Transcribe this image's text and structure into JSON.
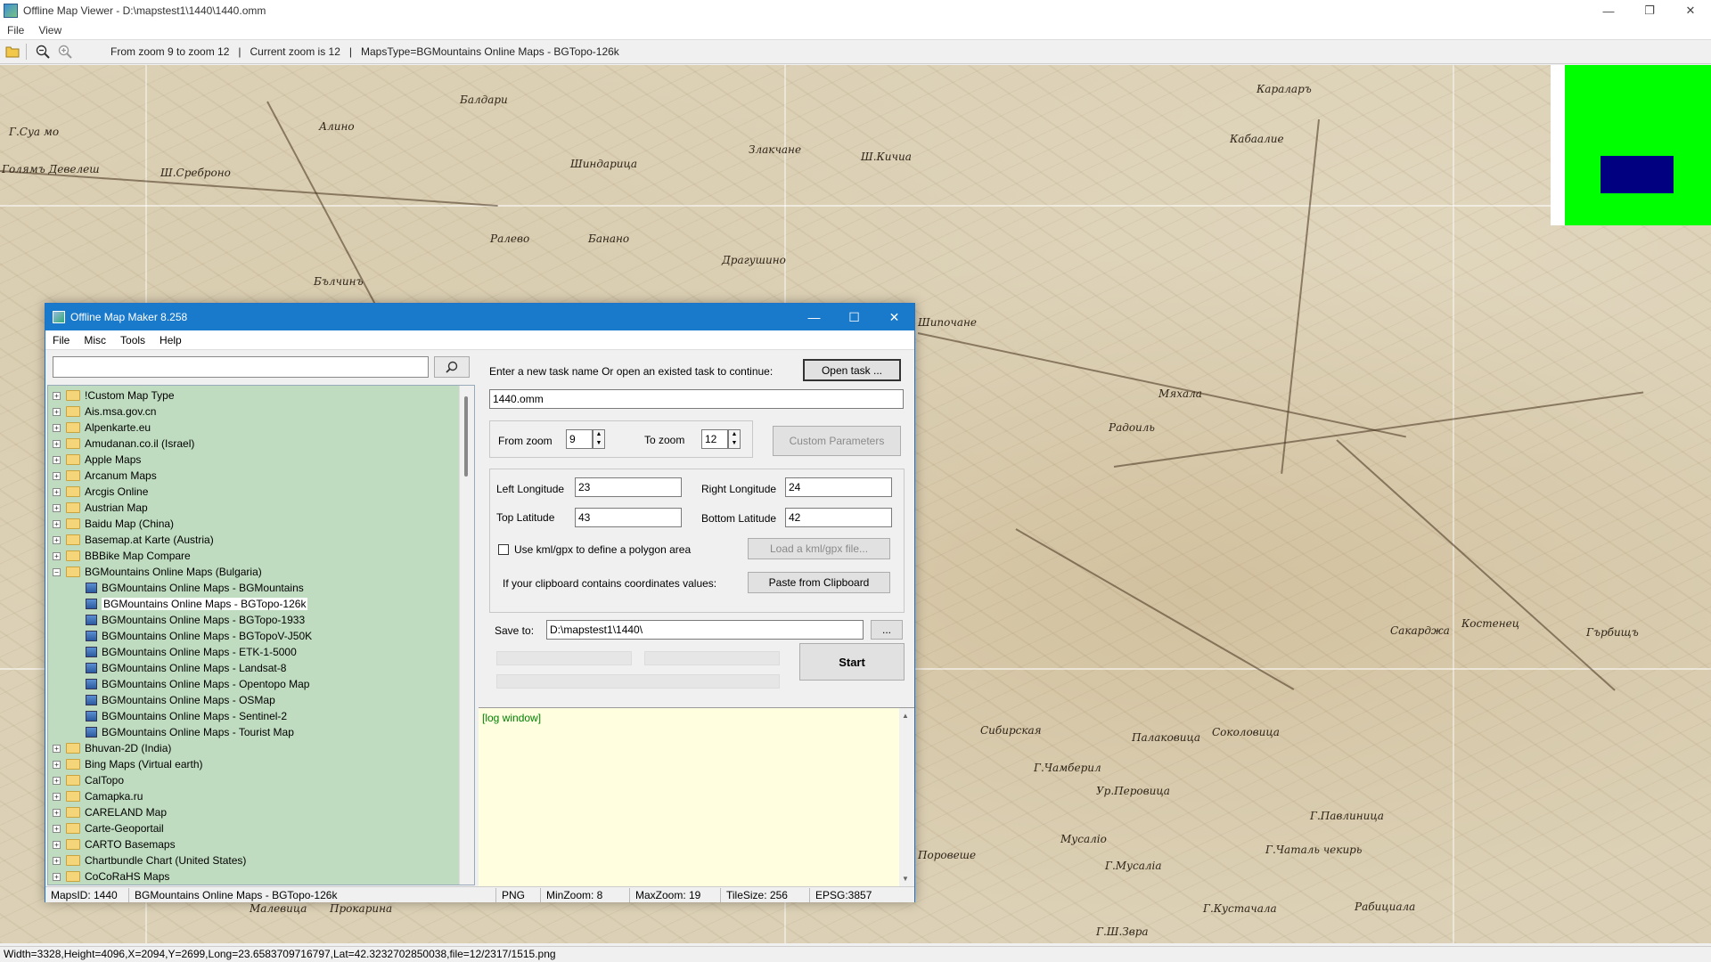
{
  "window": {
    "title": "Offline Map Viewer - D:\\mapstest1\\1440\\1440.omm",
    "controls": [
      "—",
      "❐",
      "✕"
    ]
  },
  "menubar": {
    "file": "File",
    "view": "View"
  },
  "toolbar": {
    "open_icon": "folder-open-icon",
    "zoom_out_icon": "zoom-out-icon",
    "zoom_in_icon": "zoom-in-icon",
    "info": "From zoom 9 to zoom 12   |   Current zoom is 12   |   MapsType=BGMountains Online Maps - BGTopo-126k"
  },
  "map": {
    "labels": [
      "Г.Суа мо",
      "Голямъ Девелеш",
      "Алино",
      "Ш.Среброно",
      "Балдари",
      "Шиндарица",
      "Злакчане",
      "Ш.Кичиа",
      "Караларъ",
      "Кабаалие",
      "Ралево",
      "Банано",
      "Драгушино",
      "Бълчинъ",
      "Шипочане",
      "Мяхала",
      "Радоиль",
      "Костенец",
      "Сакарджа",
      "Палаковица",
      "Сибирская",
      "Соколовица",
      "Г.Чамберил",
      "Г.Чаталь чекирь",
      "Г.Павлиница",
      "Г.Кустачала",
      "Мусаліо",
      "Прокарина",
      "Малевица",
      "Гърбищъ",
      "Ур.Перовица",
      "Рабициала",
      "Г.Мусаліа",
      "Поровеше",
      "Г.Ш.Звра"
    ],
    "overview_colors": {
      "background": "#00ff00",
      "viewport": "#000080"
    }
  },
  "statusbar": {
    "text": "Width=3328,Height=4096,X=2094,Y=2699,Long=23.6583709716797,Lat=42.3232702850038,file=12/2317/1515.png"
  },
  "dialog": {
    "title": "Offline Map Maker 8.258",
    "menu": [
      "File",
      "Misc",
      "Tools",
      "Help"
    ],
    "search": {
      "value": "",
      "icon": "search-icon"
    },
    "tree": [
      {
        "label": "!Custom Map Type",
        "expanded": false
      },
      {
        "label": "Ais.msa.gov.cn",
        "expanded": false
      },
      {
        "label": "Alpenkarte.eu",
        "expanded": false
      },
      {
        "label": "Amudanan.co.il (Israel)",
        "expanded": false
      },
      {
        "label": "Apple Maps",
        "expanded": false
      },
      {
        "label": "Arcanum Maps",
        "expanded": false
      },
      {
        "label": "Arcgis Online",
        "expanded": false
      },
      {
        "label": "Austrian Map",
        "expanded": false
      },
      {
        "label": "Baidu Map (China)",
        "expanded": false
      },
      {
        "label": "Basemap.at Karte (Austria)",
        "expanded": false
      },
      {
        "label": "BBBike Map Compare",
        "expanded": false
      },
      {
        "label": "BGMountains Online Maps (Bulgaria)",
        "expanded": true,
        "children": [
          {
            "label": "BGMountains Online Maps - BGMountains"
          },
          {
            "label": "BGMountains Online Maps - BGTopo-126k",
            "selected": true
          },
          {
            "label": "BGMountains Online Maps - BGTopo-1933"
          },
          {
            "label": "BGMountains Online Maps - BGTopoV-J50K"
          },
          {
            "label": "BGMountains Online Maps - ETK-1-5000"
          },
          {
            "label": "BGMountains Online Maps - Landsat-8"
          },
          {
            "label": "BGMountains Online Maps - Opentopo Map"
          },
          {
            "label": "BGMountains Online Maps - OSMap"
          },
          {
            "label": "BGMountains Online Maps - Sentinel-2"
          },
          {
            "label": "BGMountains Online Maps - Tourist Map"
          }
        ]
      },
      {
        "label": "Bhuvan-2D (India)",
        "expanded": false
      },
      {
        "label": "Bing Maps (Virtual earth)",
        "expanded": false
      },
      {
        "label": "CalTopo",
        "expanded": false
      },
      {
        "label": "Camapka.ru",
        "expanded": false
      },
      {
        "label": "CARELAND Map",
        "expanded": false
      },
      {
        "label": "Carte-Geoportail",
        "expanded": false
      },
      {
        "label": "CARTO Basemaps",
        "expanded": false
      },
      {
        "label": "Chartbundle Chart (United States)",
        "expanded": false
      },
      {
        "label": "CoCoRaHS Maps",
        "expanded": false
      }
    ],
    "task": {
      "prompt": "Enter a new task name Or open an existed task to continue:",
      "open_button": "Open task ...",
      "name": "1440.omm"
    },
    "zoom": {
      "from_label": "From zoom",
      "from_value": "9",
      "to_label": "To zoom",
      "to_value": "12",
      "custom_button": "Custom Parameters"
    },
    "bounds": {
      "left_lon_label": "Left Longitude",
      "left_lon": "23",
      "right_lon_label": "Right Longitude",
      "right_lon": "24",
      "top_lat_label": "Top Latitude",
      "top_lat": "43",
      "bottom_lat_label": "Bottom Latitude",
      "bottom_lat": "42",
      "kml_label": "Use kml/gpx to define a polygon area",
      "kml_button": "Load a kml/gpx file...",
      "clipboard_label": "If your clipboard contains coordinates values:",
      "clipboard_button": "Paste from Clipboard"
    },
    "save": {
      "label": "Save to:",
      "path": "D:\\mapstest1\\1440\\",
      "browse": "..."
    },
    "start_button": "Start",
    "log": "[log window]",
    "status": {
      "maps_id": "MapsID: 1440",
      "map_name": "BGMountains Online Maps - BGTopo-126k",
      "format": "PNG",
      "min_zoom": "MinZoom: 8",
      "max_zoom": "MaxZoom: 19",
      "tile_size": "TileSize: 256",
      "epsg": "EPSG:3857"
    }
  }
}
